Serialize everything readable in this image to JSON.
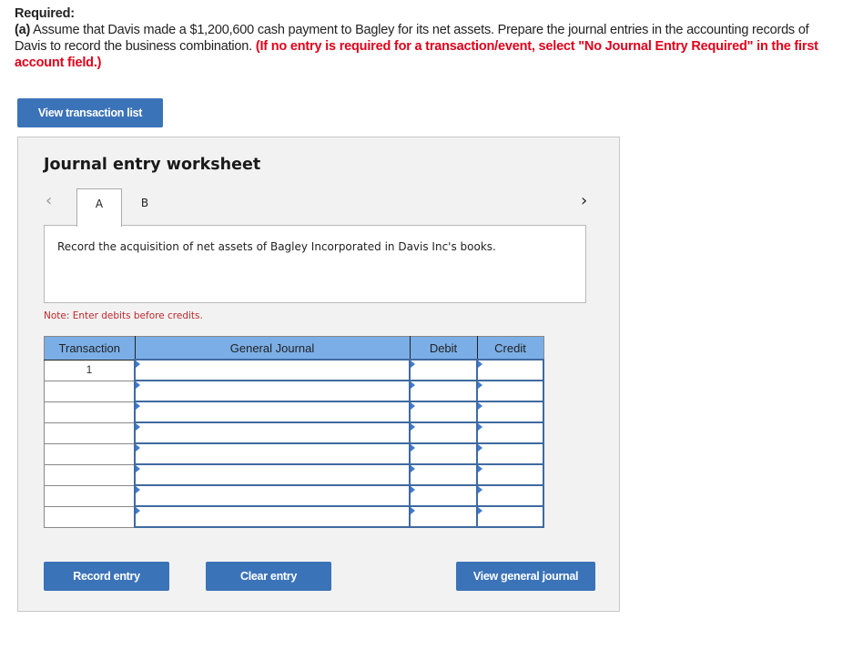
{
  "required": {
    "title": "Required:",
    "part_label": "(a)",
    "text": " Assume that Davis made a $1,200,600 cash payment to Bagley for its net assets. Prepare the journal entries in the accounting records of Davis to record the business combination. ",
    "instruction": "(If no entry is required for a transaction/event, select \"No Journal Entry Required\" in the first account field.)"
  },
  "buttons": {
    "view_transaction_list": "View transaction list",
    "record_entry": "Record entry",
    "clear_entry": "Clear entry",
    "view_general_journal": "View general journal"
  },
  "worksheet": {
    "title": "Journal entry worksheet",
    "nav_prev_icon": "‹",
    "nav_next_icon": "›",
    "tabs": [
      {
        "label": "A",
        "active": true
      },
      {
        "label": "B",
        "active": false
      }
    ],
    "description": "Record the acquisition of net assets of Bagley Incorporated in Davis Inc's books.",
    "note": "Note: Enter debits before credits."
  },
  "journal_table": {
    "headers": [
      "Transaction",
      "General Journal",
      "Debit",
      "Credit"
    ],
    "rows": [
      {
        "transaction": "1",
        "account": "",
        "debit": "",
        "credit": ""
      },
      {
        "transaction": "",
        "account": "",
        "debit": "",
        "credit": ""
      },
      {
        "transaction": "",
        "account": "",
        "debit": "",
        "credit": ""
      },
      {
        "transaction": "",
        "account": "",
        "debit": "",
        "credit": ""
      },
      {
        "transaction": "",
        "account": "",
        "debit": "",
        "credit": ""
      },
      {
        "transaction": "",
        "account": "",
        "debit": "",
        "credit": ""
      },
      {
        "transaction": "",
        "account": "",
        "debit": "",
        "credit": ""
      },
      {
        "transaction": "",
        "account": "",
        "debit": "",
        "credit": ""
      }
    ]
  },
  "colors": {
    "button_blue": "#3b73b9",
    "header_blue": "#7baee6",
    "instruction_red": "#e2001a",
    "note_red": "#c0282d"
  }
}
